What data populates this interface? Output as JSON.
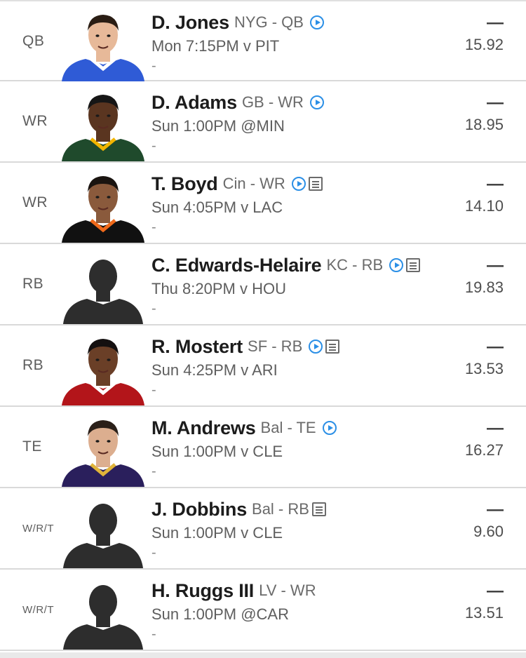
{
  "roster": [
    {
      "slot": "QB",
      "name": "D. Jones",
      "team_pos": "NYG - QB",
      "has_video": true,
      "has_news": false,
      "game": "Mon 7:15PM v PIT",
      "detail": "-",
      "score": "—",
      "projection": "15.92",
      "photo": "headshot",
      "skin": "#e7b999",
      "hair": "#2a1d14",
      "jersey": "#2f5bd6",
      "trim": "#ffffff"
    },
    {
      "slot": "WR",
      "name": "D. Adams",
      "team_pos": "GB - WR",
      "has_video": true,
      "has_news": false,
      "game": "Sun 1:00PM @MIN",
      "detail": "-",
      "score": "—",
      "projection": "18.95",
      "photo": "headshot",
      "skin": "#5a3520",
      "hair": "#161616",
      "jersey": "#1f4a2c",
      "trim": "#f2b500"
    },
    {
      "slot": "WR",
      "name": "T. Boyd",
      "team_pos": "Cin - WR",
      "has_video": true,
      "has_news": true,
      "game": "Sun 4:05PM v LAC",
      "detail": "-",
      "score": "—",
      "projection": "14.10",
      "photo": "headshot",
      "skin": "#8a5a3c",
      "hair": "#1a1410",
      "jersey": "#111111",
      "trim": "#f06a1b"
    },
    {
      "slot": "RB",
      "name": "C. Edwards-Helaire",
      "team_pos": "KC - RB",
      "has_video": true,
      "has_news": true,
      "game": "Thu 8:20PM v HOU",
      "detail": "-",
      "score": "—",
      "projection": "19.83",
      "photo": "silhouette"
    },
    {
      "slot": "RB",
      "name": "R. Mostert",
      "team_pos": "SF - RB",
      "has_video": true,
      "has_news": true,
      "game": "Sun 4:25PM v ARI",
      "detail": "-",
      "score": "—",
      "projection": "13.53",
      "photo": "headshot",
      "skin": "#6a3f27",
      "hair": "#141010",
      "jersey": "#b3151a",
      "trim": "#ffffff"
    },
    {
      "slot": "TE",
      "name": "M. Andrews",
      "team_pos": "Bal - TE",
      "has_video": true,
      "has_news": false,
      "game": "Sun 1:00PM v CLE",
      "detail": "-",
      "score": "—",
      "projection": "16.27",
      "photo": "headshot",
      "skin": "#dcae8f",
      "hair": "#2a1f18",
      "jersey": "#2a1f5c",
      "trim": "#e0b43a"
    },
    {
      "slot": "W/R/T",
      "name": "J. Dobbins",
      "team_pos": "Bal - RB",
      "has_video": false,
      "has_news": true,
      "game": "Sun 1:00PM v CLE",
      "detail": "-",
      "score": "—",
      "projection": "9.60",
      "photo": "silhouette"
    },
    {
      "slot": "W/R/T",
      "name": "H. Ruggs III",
      "team_pos": "LV - WR",
      "has_video": false,
      "has_news": false,
      "game": "Sun 1:00PM @CAR",
      "detail": "-",
      "score": "—",
      "projection": "13.51",
      "photo": "silhouette"
    }
  ]
}
